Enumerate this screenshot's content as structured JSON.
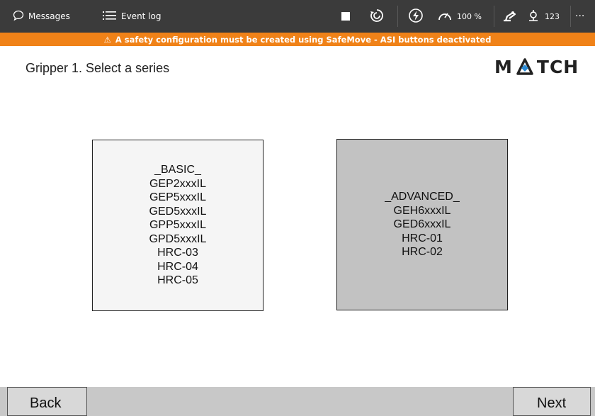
{
  "topbar": {
    "messages_label": "Messages",
    "eventlog_label": "Event log",
    "speed_value": "100 %",
    "tool_value": "123",
    "more_label": "···"
  },
  "warning": {
    "icon": "⚠",
    "text": "A safety configuration must be created using SafeMove - ASI buttons deactivated"
  },
  "page": {
    "title": "Gripper 1. Select a series"
  },
  "logo": {
    "text_left": "M",
    "text_right": "TCH",
    "accent": "#2a8ad4"
  },
  "series": [
    {
      "id": "basic",
      "lines": [
        "_BASIC_",
        "GEP2xxxIL",
        "GEP5xxxIL",
        "GED5xxxIL",
        "GPP5xxxIL",
        "GPD5xxxIL",
        "HRC-03",
        "HRC-04",
        "HRC-05"
      ],
      "bg": "#f5f5f5"
    },
    {
      "id": "advanced",
      "lines": [
        "_ADVANCED_",
        "GEH6xxxIL",
        "GED6xxxIL",
        "HRC-01",
        "HRC-02"
      ],
      "bg": "#c2c2c2"
    }
  ],
  "nav": {
    "back_label": "Back",
    "next_label": "Next"
  },
  "colors": {
    "topbar": "#3b3b3b",
    "warning": "#f08218",
    "bottombar": "#c8c8c8"
  }
}
